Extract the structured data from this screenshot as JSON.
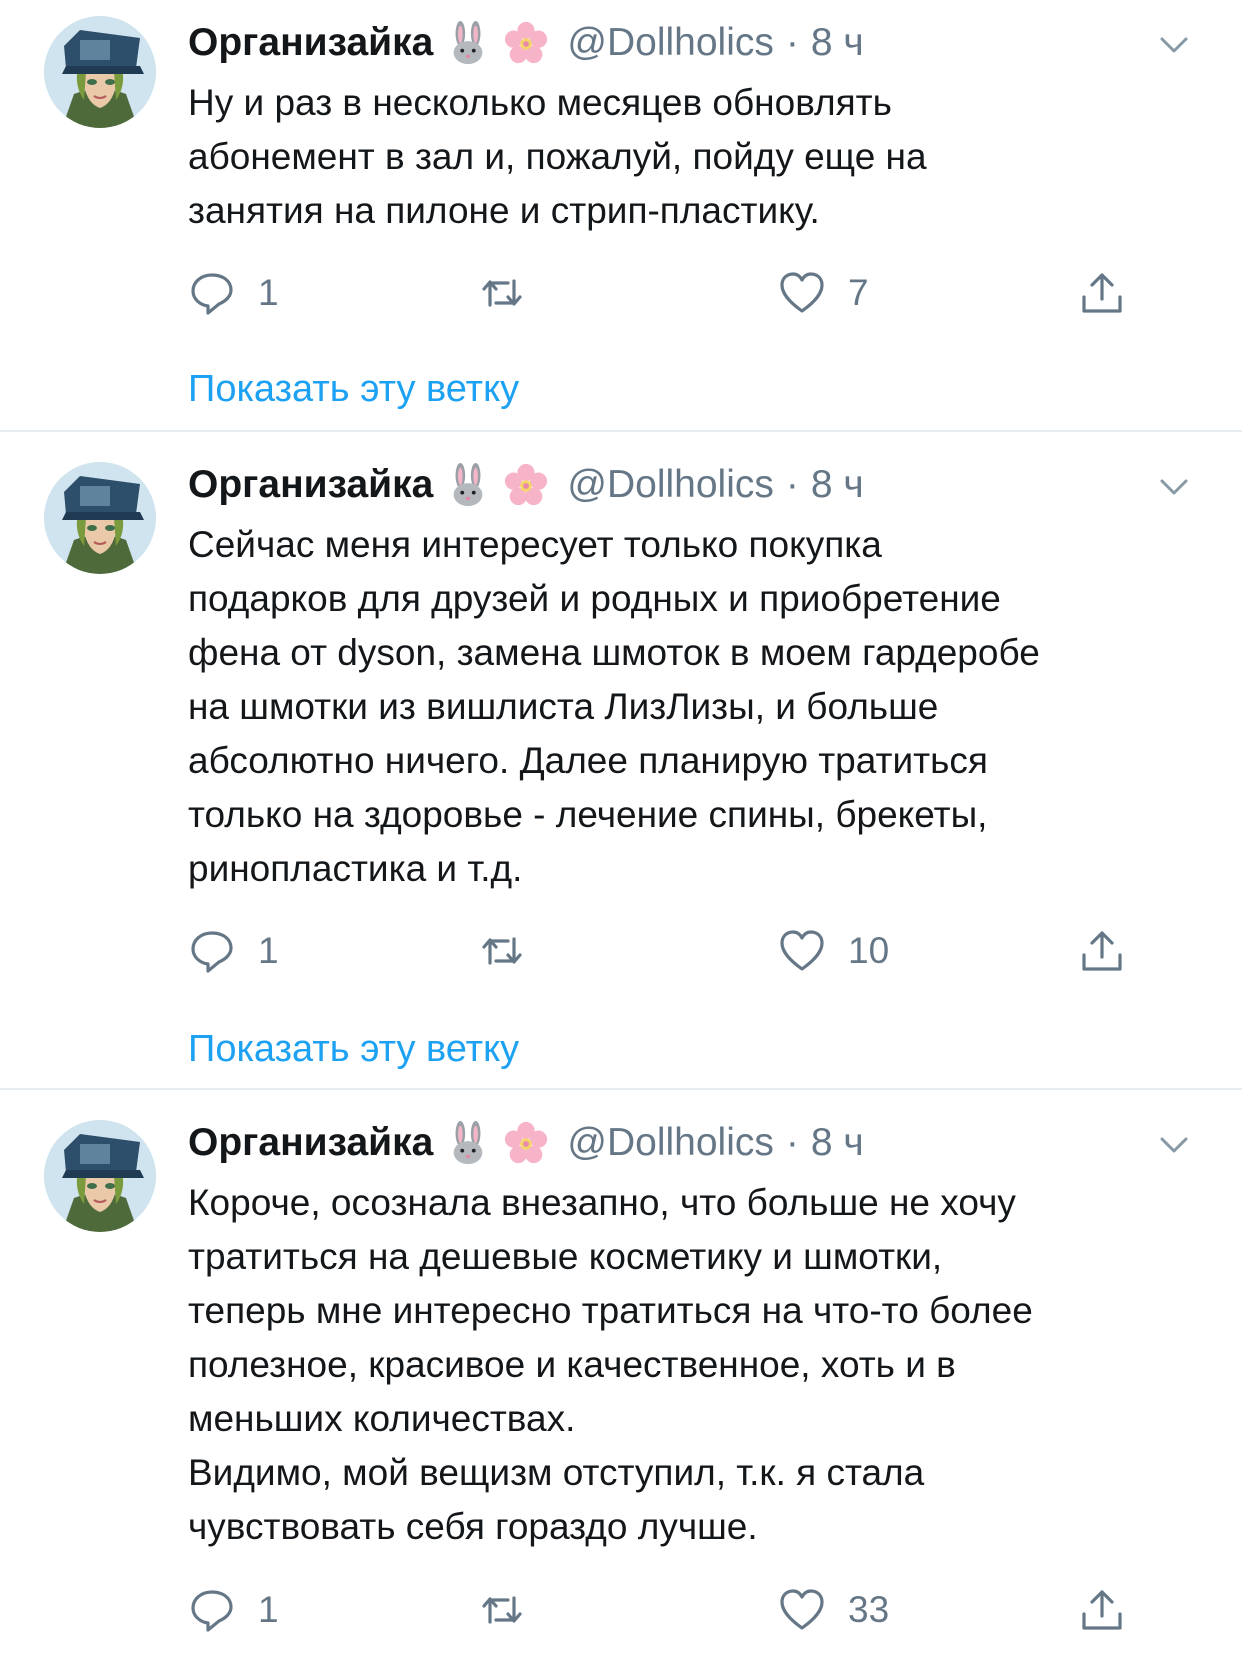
{
  "colors": {
    "text": "#14171a",
    "secondary": "#657786",
    "link": "#1da1f2",
    "divider": "#e6ecf0"
  },
  "tweets": [
    {
      "author_name": "Организайка",
      "emojis": [
        "rabbit-face-emoji",
        "cherry-blossom-emoji"
      ],
      "handle": "@Dollholics",
      "separator": "·",
      "time": "8 ч",
      "text": "Ну и раз в несколько месяцев обновлять\nабонемент в зал и,  пожалуй, пойду еще на\nзанятия на пилоне и стрип-пластику.",
      "replies": "1",
      "retweets": "",
      "likes": "7",
      "show_thread": "Показать эту ветку"
    },
    {
      "author_name": "Организайка",
      "emojis": [
        "rabbit-face-emoji",
        "cherry-blossom-emoji"
      ],
      "handle": "@Dollholics",
      "separator": "·",
      "time": "8 ч",
      "text": "Сейчас меня интересует только покупка\nподарков для друзей и родных и приобретение\nфена от dyson, замена шмоток в моем гардеробе\nна шмотки из вишлиста ЛизЛизы, и больше\nабсолютно ничего. Далее планирую тратиться\nтолько на здоровье - лечение спины, брекеты,\nринопластика и т.д.",
      "replies": "1",
      "retweets": "",
      "likes": "10",
      "show_thread": "Показать эту ветку"
    },
    {
      "author_name": "Организайка",
      "emojis": [
        "rabbit-face-emoji",
        "cherry-blossom-emoji"
      ],
      "handle": "@Dollholics",
      "separator": "·",
      "time": "8 ч",
      "text": "Короче, осознала внезапно, что больше не хочу\nтратиться на дешевые косметику и шмотки,\nтеперь мне интересно тратиться на что-то более\nполезное, красивое и качественное, хоть и в\nменьших количествах.\nВидимо, мой вещизм отступил, т.к. я стала\nчувствовать себя гораздо лучше.",
      "replies": "1",
      "retweets": "",
      "likes": "33"
    }
  ]
}
